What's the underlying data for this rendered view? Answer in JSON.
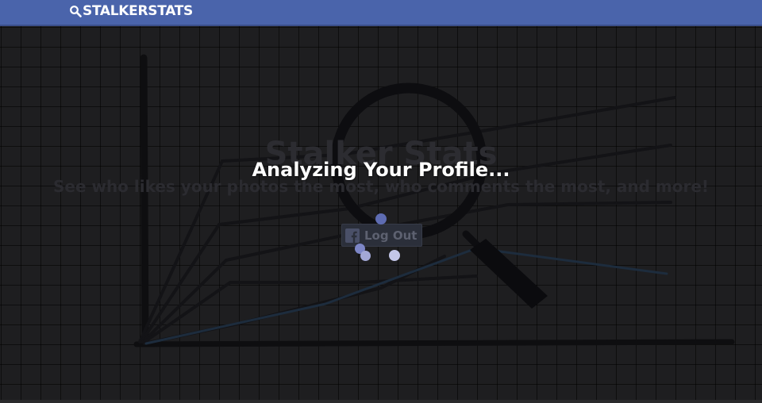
{
  "app": {
    "brand": "STALKERSTATS",
    "brand_icon": "magnifier-icon"
  },
  "hero": {
    "title": "Stalker Stats",
    "subtitle": "See who likes your photos the most, who comments the most, and more!"
  },
  "auth": {
    "logout_label": "Log Out",
    "logout_icon": "facebook-icon"
  },
  "overlay": {
    "status_text": "Analyzing Your Profile...",
    "spinner_icon": "loading-spinner"
  },
  "colors": {
    "topbar": "#4a64ab",
    "background": "#1e1e20",
    "overlay_text": "#ffffff",
    "spinner_dot": "#c3c6e8"
  }
}
